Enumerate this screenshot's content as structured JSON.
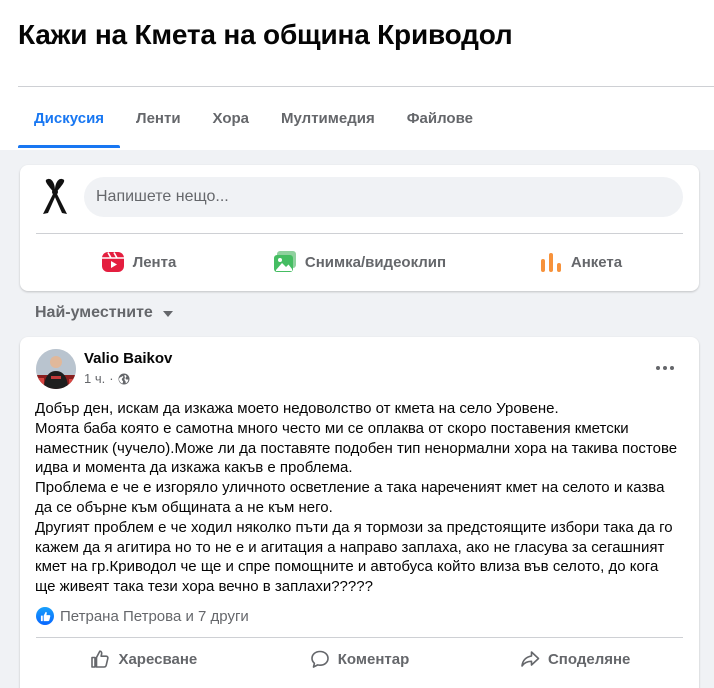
{
  "group": {
    "title": "Кажи на Кмета на община Криводол"
  },
  "tabs": [
    {
      "label": "Дискусия",
      "active": true
    },
    {
      "label": "Ленти"
    },
    {
      "label": "Хора"
    },
    {
      "label": "Мултимедия"
    },
    {
      "label": "Файлове"
    }
  ],
  "composer": {
    "placeholder": "Напишете нещо...",
    "actions": [
      {
        "label": "Лента",
        "icon": "reel-icon",
        "color": "#e41e3f"
      },
      {
        "label": "Снимка/видеоклип",
        "icon": "photo-video-icon",
        "color": "#45bd62"
      },
      {
        "label": "Анкета",
        "icon": "poll-icon",
        "color": "#f7923b"
      }
    ]
  },
  "sort": {
    "label": "Най-уместните"
  },
  "post": {
    "author": "Valio Baikov",
    "time": "1 ч.",
    "separator": "·",
    "lines": [
      "Добър ден, искам да изкажа моето недоволство от кмета на село Уровене.",
      "Моята баба която е самотна много често ми се оплаква от скоро поставения кметски",
      "наместник (чучело).Може ли да поставяте подобен тип ненормални хора на такива постове",
      "идва и момента да изкажа какъв е проблема.",
      "Проблема е че е изгоряло уличното осветление а така нареченият кмет на селото и казва",
      "да се обърне към общината а не към него.",
      "Другият проблем е че ходил няколко пъти да я тормози за предстоящите избори така да го",
      "кажем да я агитира но то не е и агитация а направо заплаха, ако не гласува за сегашният",
      "кмет на гр.Криводол че ще и спре помощните и автобуса който влиза във селото, до кога",
      "ще живеят така тези хора вечно в заплахи?????"
    ],
    "reactions": "Петрана Петрова и 7 други",
    "actions": {
      "like": "Харесване",
      "comment": "Коментар",
      "share": "Споделяне"
    }
  },
  "colors": {
    "accent": "#1877f2",
    "secondary_text": "#65676b"
  }
}
